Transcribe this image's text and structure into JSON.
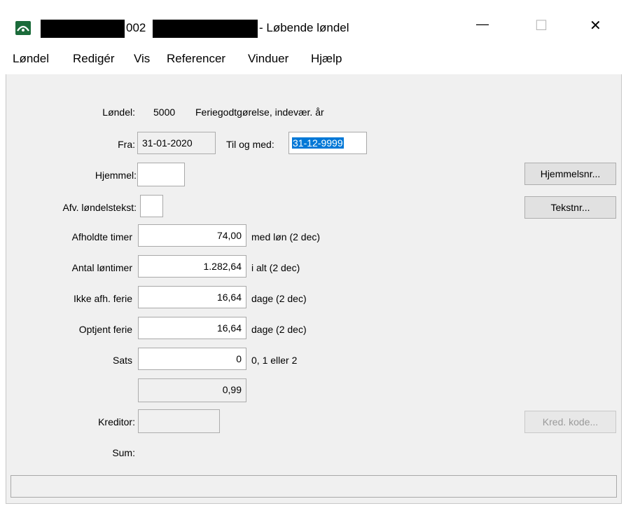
{
  "window": {
    "title_prefix": "002",
    "title_suffix": "- Løbende løndel",
    "controls": {
      "minimize": "—",
      "maximize": "☐",
      "close": "✕"
    }
  },
  "menu": [
    "Løndel",
    "Redigér",
    "Vis",
    "Referencer",
    "Vinduer",
    "Hjælp"
  ],
  "form": {
    "loendel_label": "Løndel:",
    "loendel_number": "5000",
    "loendel_name": "Feriegodtgørelse, indevær. år",
    "fra_label": "Fra:",
    "fra_value": "31-01-2020",
    "til_label": "Til og med:",
    "til_value": "31-12-9999",
    "hjemmel_label": "Hjemmel:",
    "hjemmel_value": "",
    "afv_label": "Afv. løndelstekst:",
    "afv_value": "",
    "afholdte_label": "Afholdte timer",
    "afholdte_value": "74,00",
    "afholdte_hint": "med løn (2 dec)",
    "antal_label": "Antal løntimer",
    "antal_value": "1.282,64",
    "antal_hint": "i alt (2 dec)",
    "ikke_label": "Ikke afh. ferie",
    "ikke_value": "16,64",
    "ikke_hint": "dage (2 dec)",
    "optjent_label": "Optjent ferie",
    "optjent_value": "16,64",
    "optjent_hint": "dage (2 dec)",
    "sats_label": "Sats",
    "sats_value": "0",
    "sats_hint": "0, 1 eller 2",
    "computed_value": "0,99",
    "kreditor_label": "Kreditor:",
    "kreditor_value": "",
    "sum_label": "Sum:"
  },
  "buttons": {
    "hjemmelsnr": "Hjemmelsnr...",
    "tekstnr": "Tekstnr...",
    "kred_kode": "Kred. kode..."
  },
  "colors": {
    "selection": "#0078d7",
    "client_bg": "#f0f0f0",
    "app_icon": "#1b6b3a"
  }
}
